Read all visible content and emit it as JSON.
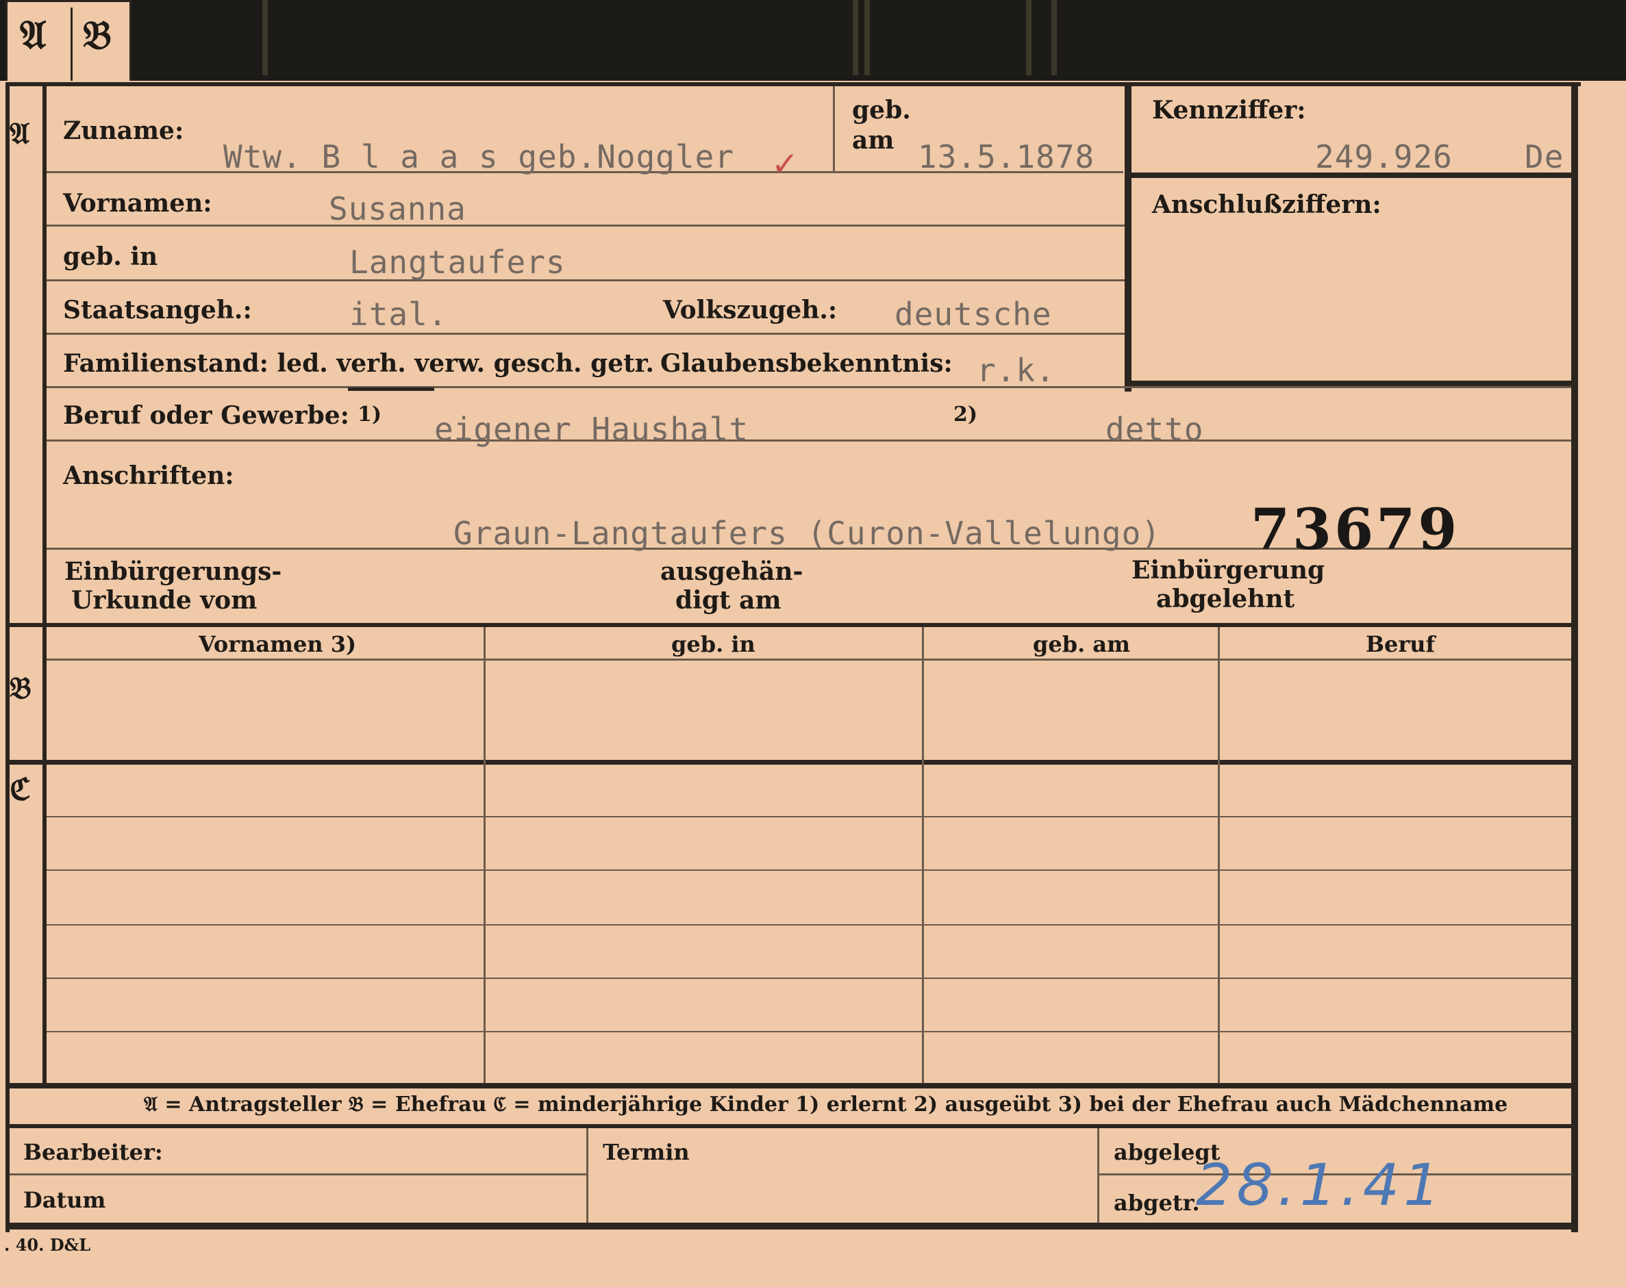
{
  "tabs": {
    "a": "𝔄",
    "b": "𝔅"
  },
  "sections": {
    "a": "𝔄",
    "b": "𝔅",
    "c": "ℭ"
  },
  "fields": {
    "zuname_label": "Zuname:",
    "zuname_value": "Wtw. B l a a s  geb.Noggler",
    "geb_label": "geb.",
    "am_label": "am",
    "geb_am_value": "13.5.1878",
    "kennziffer_label": "Kennziffer:",
    "kennziffer_value": "249.926",
    "kennziffer_suffix": "De",
    "anschluss_label": "Anschlußziffern:",
    "vornamen_label": "Vornamen:",
    "vornamen_value": "Susanna",
    "gebin_label": "geb. in",
    "gebin_value": "Langtaufers",
    "staats_label": "Staatsangeh.:",
    "staats_value": "ital.",
    "volks_label": "Volkszugeh.:",
    "volks_value": "deutsche",
    "familien_label": "Familienstand: led. verh. verw. gesch. getr.",
    "glauben_label": "Glaubensbekenntnis:",
    "glauben_value": "r.k.",
    "beruf_label": "Beruf oder Gewerbe:",
    "beruf_mark1": "1)",
    "beruf_value1": "eigener Haushalt",
    "beruf_mark2": "2)",
    "beruf_value2": "detto",
    "anschriften_label": "Anschriften:",
    "anschriften_value": "Graun-Langtaufers  (Curon-Vallelungo)",
    "stamp_number": "73679",
    "einb_urkunde_line1": "Einbürgerungs-",
    "einb_urkunde_line2": "Urkunde vom",
    "ausgeh_line1": "ausgehän-",
    "ausgeh_line2": "digt am",
    "abgelehnt_line1": "Einbürgerung",
    "abgelehnt_line2": "abgelehnt"
  },
  "table_headers": [
    "Vornamen 3)",
    "geb. in",
    "geb. am",
    "Beruf"
  ],
  "legend": "𝔄 = Antragsteller   𝔅 = Ehefrau   ℭ = minderjährige Kinder   1) erlernt   2) ausgeübt   3) bei der Ehefrau auch Mädchenname",
  "footer": {
    "bearbeiter": "Bearbeiter:",
    "datum": "Datum",
    "termin": "Termin",
    "abgelegt": "abgelegt",
    "abgetr": "abgetr.",
    "abgetr_value": "28.1.41",
    "print_mark": ". 40. D&L"
  }
}
